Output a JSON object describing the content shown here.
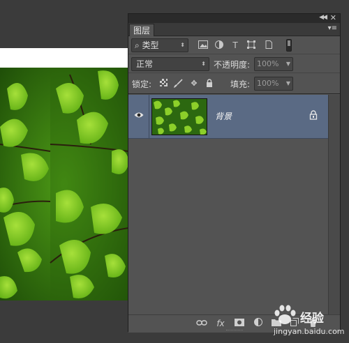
{
  "panel": {
    "tab_label": "图层",
    "filter": {
      "kind_label": "类型"
    },
    "blend": {
      "mode": "正常",
      "opacity_label": "不透明度:",
      "opacity_value": "100%"
    },
    "lock": {
      "label": "锁定:",
      "fill_label": "填充:",
      "fill_value": "100%"
    },
    "layers": [
      {
        "name": "背景",
        "visible": true,
        "locked": true,
        "selected": true
      }
    ]
  },
  "icons": {
    "collapse": "collapse-icon",
    "close": "close-icon",
    "panel_menu": "panel-menu-icon",
    "search": "search-icon"
  },
  "colors": {
    "panel_bg": "#535353",
    "selected_layer": "#5a6a84",
    "workspace_bg": "#3b3b3b",
    "leaf_green": "#6fbf1f"
  },
  "watermark": {
    "brand": "经验",
    "url": "jingyan.baidu.com"
  }
}
